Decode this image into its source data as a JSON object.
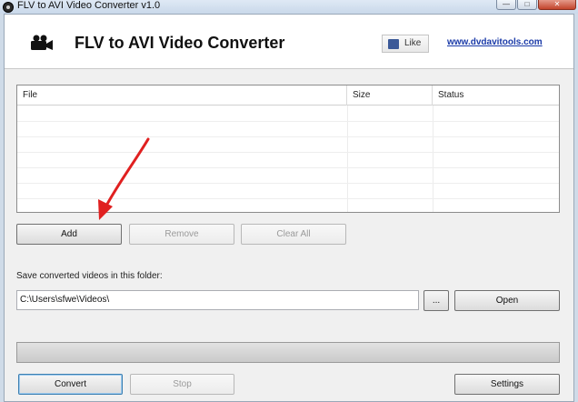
{
  "window": {
    "title": "FLV to AVI Video Converter v1.0",
    "buttons": {
      "minimize": "—",
      "maximize": "□",
      "close": "✕"
    }
  },
  "header": {
    "app_title": "FLV to AVI Video Converter",
    "like_label": "Like",
    "site_link": "www.dvdavitools.com",
    "logo_icon": "video-camera-icon"
  },
  "file_list": {
    "columns": [
      "File",
      "Size",
      "Status"
    ],
    "rows": []
  },
  "list_buttons": {
    "add": "Add",
    "remove": "Remove",
    "clear_all": "Clear All"
  },
  "output": {
    "label": "Save converted videos in this folder:",
    "path": "C:\\Users\\sfwe\\Videos\\",
    "browse": "...",
    "open": "Open"
  },
  "progress": {
    "value": 0
  },
  "actions": {
    "convert": "Convert",
    "stop": "Stop",
    "settings": "Settings"
  },
  "colors": {
    "annotation_arrow": "#e02020",
    "link": "#1a3aa8"
  }
}
